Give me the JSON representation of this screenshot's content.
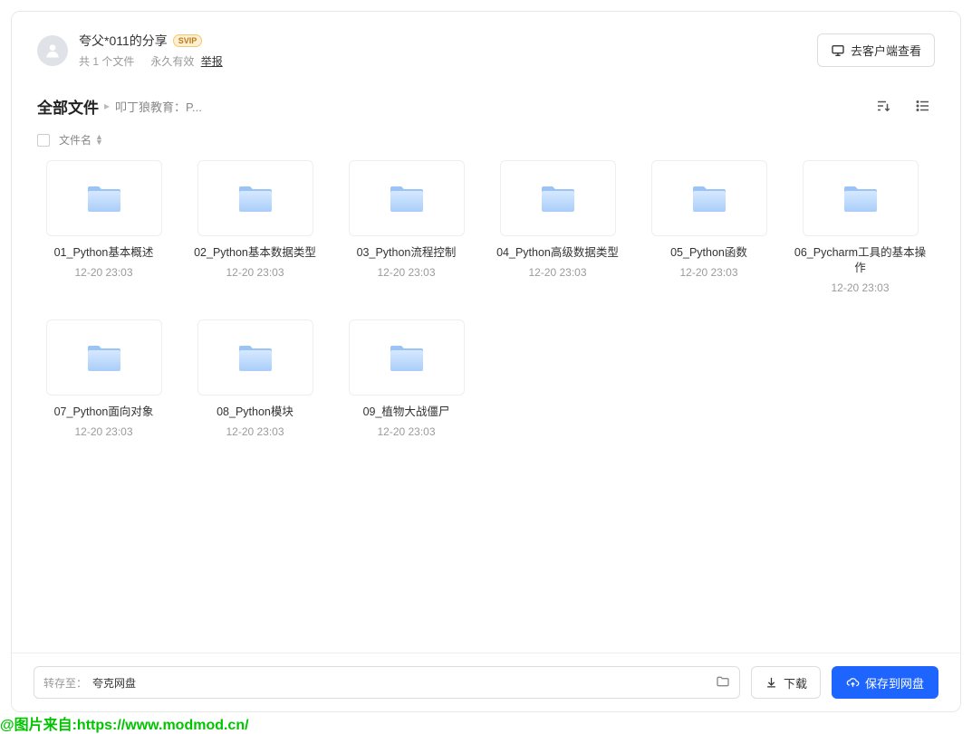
{
  "header": {
    "share_title": "夸父*011的分享",
    "vip_badge": "SVIP",
    "file_count_text": "共 1 个文件",
    "validity_text": "永久有效",
    "report_text": "举报",
    "client_button": "去客户端查看"
  },
  "breadcrumb": {
    "root": "全部文件",
    "sub": "叩丁狼教育：P..."
  },
  "list_header": {
    "name_col": "文件名"
  },
  "files": [
    {
      "name": "01_Python基本概述",
      "date": "12-20 23:03"
    },
    {
      "name": "02_Python基本数据类型",
      "date": "12-20 23:03"
    },
    {
      "name": "03_Python流程控制",
      "date": "12-20 23:03"
    },
    {
      "name": "04_Python高级数据类型",
      "date": "12-20 23:03"
    },
    {
      "name": "05_Python函数",
      "date": "12-20 23:03"
    },
    {
      "name": "06_Pycharm工具的基本操作",
      "date": "12-20 23:03"
    },
    {
      "name": "07_Python面向对象",
      "date": "12-20 23:03"
    },
    {
      "name": "08_Python模块",
      "date": "12-20 23:03"
    },
    {
      "name": "09_植物大战僵尸",
      "date": "12-20 23:03"
    }
  ],
  "bottom": {
    "dest_label": "转存至：",
    "dest_value": "夸克网盘",
    "download_label": "下载",
    "save_label": "保存到网盘"
  },
  "colors": {
    "accent": "#1e65ff",
    "folder_top": "#b8d6ff",
    "folder_body": "#d1e4ff"
  },
  "watermark": "@图片来自:https://www.modmod.cn/"
}
